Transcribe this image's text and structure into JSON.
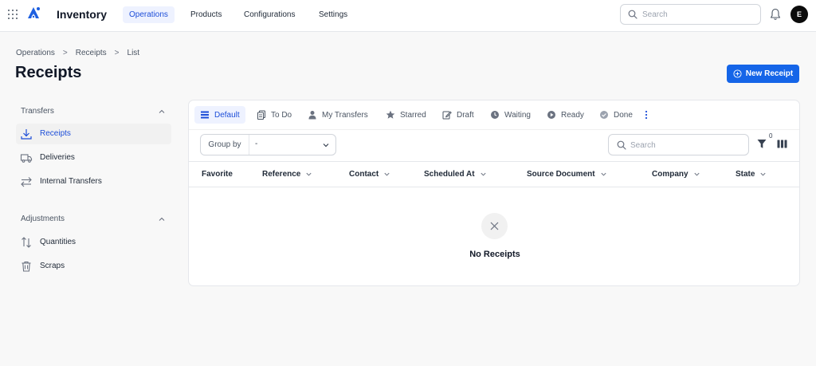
{
  "app": {
    "title": "Inventory"
  },
  "nav": {
    "items": [
      {
        "label": "Operations",
        "active": true
      },
      {
        "label": "Products",
        "active": false
      },
      {
        "label": "Configurations",
        "active": false
      },
      {
        "label": "Settings",
        "active": false
      }
    ]
  },
  "top_search": {
    "placeholder": "Search"
  },
  "user": {
    "initial": "E"
  },
  "breadcrumb": [
    "Operations",
    "Receipts",
    "List"
  ],
  "page": {
    "title": "Receipts",
    "new_button_label": "New Receipt"
  },
  "sidebar": {
    "sections": [
      {
        "label": "Transfers",
        "items": [
          {
            "label": "Receipts",
            "icon": "receipt-download-icon",
            "active": true
          },
          {
            "label": "Deliveries",
            "icon": "truck-icon",
            "active": false
          },
          {
            "label": "Internal Transfers",
            "icon": "arrows-swap-icon",
            "active": false
          }
        ]
      },
      {
        "label": "Adjustments",
        "items": [
          {
            "label": "Quantities",
            "icon": "arrows-up-down-icon",
            "active": false
          },
          {
            "label": "Scraps",
            "icon": "trash-icon",
            "active": false
          }
        ]
      }
    ]
  },
  "tabs": [
    {
      "label": "Default",
      "icon": "list-icon",
      "active": true
    },
    {
      "label": "To Do",
      "icon": "clipboard-icon",
      "active": false
    },
    {
      "label": "My Transfers",
      "icon": "user-icon",
      "active": false
    },
    {
      "label": "Starred",
      "icon": "star-icon",
      "active": false
    },
    {
      "label": "Draft",
      "icon": "pencil-icon",
      "active": false
    },
    {
      "label": "Waiting",
      "icon": "clock-icon",
      "active": false
    },
    {
      "label": "Ready",
      "icon": "play-circle-icon",
      "active": false
    },
    {
      "label": "Done",
      "icon": "check-circle-icon",
      "active": false
    }
  ],
  "toolbar": {
    "group_by_label": "Group by",
    "group_by_value": "-",
    "search_placeholder": "Search",
    "filter_count": "0"
  },
  "table": {
    "columns": [
      "Favorite",
      "Reference",
      "Contact",
      "Scheduled At",
      "Source Document",
      "Company",
      "State"
    ],
    "rows": [],
    "empty_text": "No Receipts"
  },
  "colors": {
    "accent": "#1565e8",
    "active_bg": "#eef2ff"
  }
}
